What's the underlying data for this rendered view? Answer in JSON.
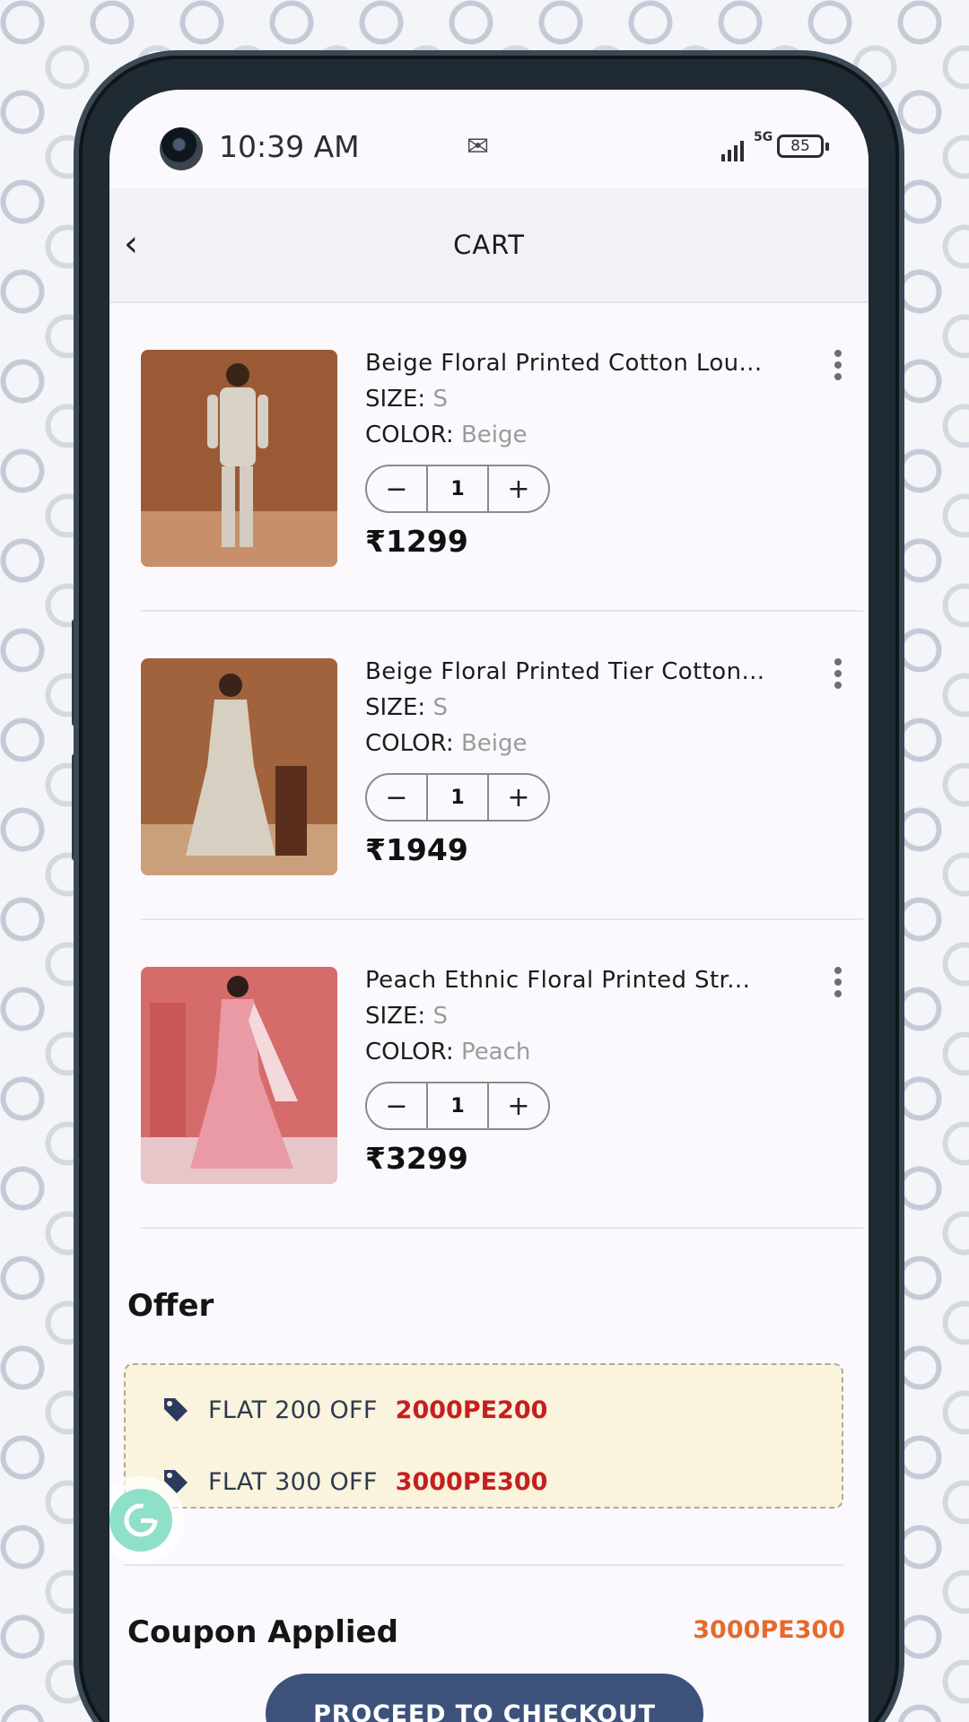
{
  "status_bar": {
    "time": "10:39 AM",
    "network": "5G",
    "battery": "85"
  },
  "header": {
    "title": "CART"
  },
  "labels": {
    "size": "SIZE: ",
    "color": "COLOR: "
  },
  "cart_items": [
    {
      "name": "Beige Floral Printed Cotton Lou...",
      "size": "S",
      "color": "Beige",
      "quantity": "1",
      "price": "₹1299"
    },
    {
      "name": "Beige Floral Printed Tier Cotton...",
      "size": "S",
      "color": "Beige",
      "quantity": "1",
      "price": "₹1949"
    },
    {
      "name": "Peach Ethnic Floral Printed Str...",
      "size": "S",
      "color": "Peach",
      "quantity": "1",
      "price": "₹3299"
    }
  ],
  "offer": {
    "title": "Offer",
    "items": [
      {
        "text": "FLAT 200 OFF",
        "code": "2000PE200"
      },
      {
        "text": "FLAT 300 OFF",
        "code": "3000PE300"
      }
    ]
  },
  "coupon": {
    "title": "Coupon Applied",
    "code": "3000PE300"
  },
  "checkout": {
    "label": "PROCEED TO CHECKOUT"
  },
  "colors": {
    "accent": "#3d527a",
    "offer_code": "#c51f1f",
    "applied_code": "#e66a2c",
    "offer_bg": "#faf3dd"
  },
  "stepper": {
    "minus": "−",
    "plus": "+"
  },
  "icons": {
    "back": "back-arrow-icon",
    "more": "more-vertical-icon",
    "tag": "tag-icon",
    "mail": "gmail-icon",
    "grammarly": "grammarly-icon"
  }
}
